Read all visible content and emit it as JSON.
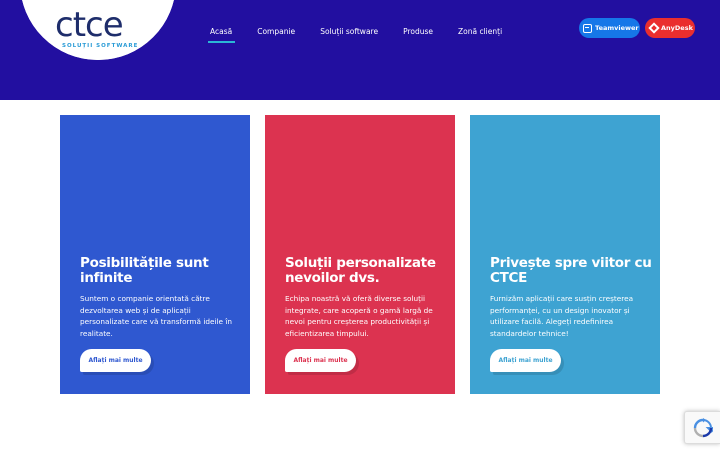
{
  "logo": {
    "text": "ctce",
    "subtitle": "SOLUȚII SOFTWARE"
  },
  "nav": {
    "items": [
      {
        "label": "Acasă",
        "active": true
      },
      {
        "label": "Companie",
        "active": false
      },
      {
        "label": "Soluții software",
        "active": false
      },
      {
        "label": "Produse",
        "active": false
      },
      {
        "label": "Zonă clienți",
        "active": false
      }
    ]
  },
  "remote": {
    "teamviewer_label": "Teamviewer",
    "anydesk_label": "AnyDesk"
  },
  "cards": [
    {
      "title": "Posibilitățile sunt infinite",
      "text": "Suntem o companie orientată către dezvoltarea web și de aplicații personalizate care vă transformă ideile în realitate.",
      "button": "Aflați mai multe",
      "color": "#2f58d0"
    },
    {
      "title": "Soluții personalizate nevoilor dvs.",
      "text": "Echipa noastră vă oferă diverse soluții integrate, care acoperă o gamă largă de nevoi pentru creșterea productivității și eficientizarea timpului.",
      "button": "Aflați mai multe",
      "color": "#dc3350"
    },
    {
      "title": "Privește spre viitor cu CTCE",
      "text": "Furnizăm aplicații care susțin creșterea performanței, cu un design inovator și utilizare facilă. Alegeți redefinirea standardelor tehnice!",
      "button": "Aflați mai multe",
      "color": "#3ea3d2"
    }
  ],
  "colors": {
    "header_bg": "#220fa0",
    "nav_active_underline": "#2bb7d6",
    "teamviewer": "#1677e8",
    "anydesk": "#ea2e2e"
  },
  "icons": {
    "teamviewer": "teamviewer-icon",
    "anydesk": "anydesk-icon",
    "recaptcha": "recaptcha-icon"
  }
}
